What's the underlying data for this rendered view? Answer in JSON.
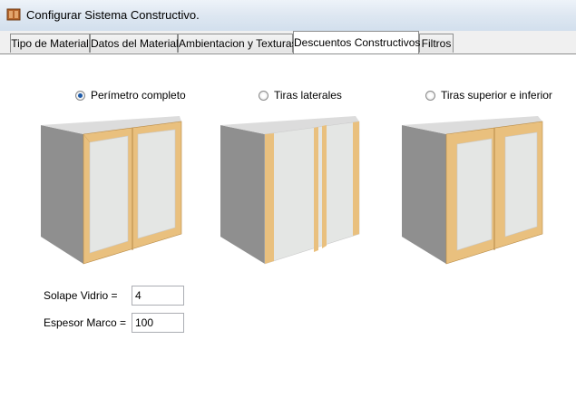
{
  "window": {
    "title": "Configurar Sistema Constructivo."
  },
  "tabs": [
    {
      "label": "Tipo de Material"
    },
    {
      "label": "Datos del Material"
    },
    {
      "label": "Ambientacion y Texturas"
    },
    {
      "label": "Descuentos Constructivos",
      "active": true
    },
    {
      "label": "Filtros"
    }
  ],
  "options": [
    {
      "label": "Perímetro completo",
      "selected": true
    },
    {
      "label": "Tiras laterales",
      "selected": false
    },
    {
      "label": "Tiras superior e inferior",
      "selected": false
    }
  ],
  "fields": {
    "solape_label": "Solape Vidrio =",
    "solape_value": "4",
    "espesor_label": "Espesor Marco =",
    "espesor_value": "100"
  },
  "colors": {
    "frame": "#e9c07e",
    "side": "#8f8f8f",
    "top": "#dcdcdc",
    "glass": "#e4e6e4"
  }
}
